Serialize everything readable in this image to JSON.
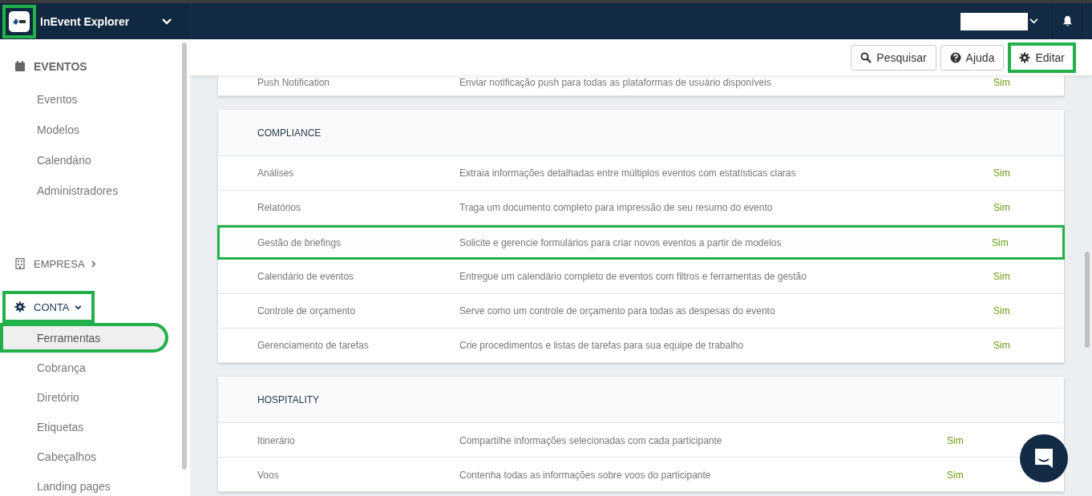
{
  "header": {
    "app_name": "InEvent Explorer",
    "logo_highlighted": true
  },
  "sidebar": {
    "sections": [
      {
        "kind": "plain",
        "label": "EVENTOS",
        "highlighted": false,
        "items": [
          {
            "label": "Eventos",
            "selected": false,
            "highlighted": false
          },
          {
            "label": "Modelos",
            "selected": false,
            "highlighted": false
          },
          {
            "label": "Calendário",
            "selected": false,
            "highlighted": false
          },
          {
            "label": "Administradores",
            "selected": false,
            "highlighted": false
          }
        ]
      },
      {
        "kind": "toggle",
        "label": "EMPRESA",
        "expanded": false,
        "highlighted": false
      },
      {
        "kind": "toggle",
        "label": "CONTA",
        "expanded": true,
        "highlighted": true,
        "items": [
          {
            "label": "Ferramentas",
            "selected": true,
            "highlighted": true
          },
          {
            "label": "Cobrança",
            "selected": false,
            "highlighted": false
          },
          {
            "label": "Diretório",
            "selected": false,
            "highlighted": false
          },
          {
            "label": "Etiquetas",
            "selected": false,
            "highlighted": false
          },
          {
            "label": "Cabeçalhos",
            "selected": false,
            "highlighted": false
          },
          {
            "label": "Landing pages",
            "selected": false,
            "highlighted": false
          }
        ]
      }
    ]
  },
  "toolbar": {
    "buttons": [
      {
        "kind": "search",
        "label": "Pesquisar",
        "highlighted": false
      },
      {
        "kind": "help",
        "label": "Ajuda",
        "highlighted": false
      },
      {
        "kind": "settings",
        "label": "Editar",
        "highlighted": true
      }
    ]
  },
  "cards": [
    {
      "rows": [
        {
          "name": "Push Notification",
          "description": "Enviar notificação push para todas as plataformas de usuário disponíveis",
          "value": "Sim",
          "highlighted": false
        }
      ]
    },
    {
      "title": "COMPLIANCE",
      "rows": [
        {
          "name": "Análises",
          "description": "Extraia informações detalhadas entre múltiplos eventos com estatísticas claras",
          "value": "Sim",
          "highlighted": false
        },
        {
          "name": "Relatórios",
          "description": "Traga um documento completo para impressão de seu resumo do evento",
          "value": "Sim",
          "highlighted": false
        },
        {
          "name": "Gestão de briefings",
          "description": "Solicite e gerencie formulários para criar novos eventos a partir de modelos",
          "value": "Sim",
          "highlighted": true
        },
        {
          "name": "Calendário de eventos",
          "description": "Entregue um calendário completo de eventos com filtros e ferramentas de gestão",
          "value": "Sim",
          "highlighted": false
        },
        {
          "name": "Controle de orçamento",
          "description": "Serve como um controle de orçamento para todas as despesas do evento",
          "value": "Sim",
          "highlighted": false
        },
        {
          "name": "Gerenciamento de tarefas",
          "description": "Crie procedimentos e listas de tarefas para sua equipe de trabalho",
          "value": "Sim",
          "highlighted": false
        }
      ]
    },
    {
      "title": "HOSPITALITY",
      "rows": [
        {
          "name": "Itinerário",
          "description": "Compartilhe informações selecionadas com cada participante",
          "value": "Sim",
          "highlighted": false
        },
        {
          "name": "Voos",
          "description": "Contenha todas as informações sobre voos do participante",
          "value": "Sim",
          "highlighted": false
        }
      ]
    }
  ]
}
